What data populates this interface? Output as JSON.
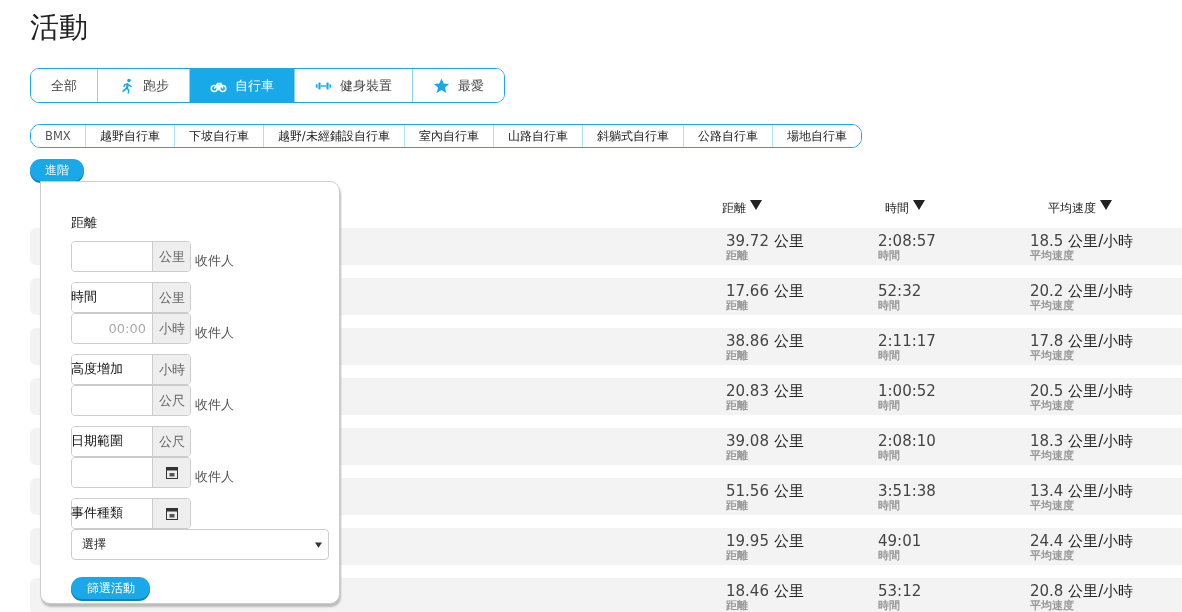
{
  "title": "活動",
  "tabs": [
    {
      "label": "全部",
      "selected": false
    },
    {
      "label": "跑步",
      "selected": false
    },
    {
      "label": "自行車",
      "selected": true
    },
    {
      "label": "健身裝置",
      "selected": false
    },
    {
      "label": "最愛",
      "selected": false
    }
  ],
  "subtypes": [
    "BMX",
    "越野自行車",
    "下坡自行車",
    "越野/未經鋪設自行車",
    "室內自行車",
    "山路自行車",
    "斜躺式自行車",
    "公路自行車",
    "場地自行車"
  ],
  "advanced_button": "進階",
  "filter_panel": {
    "groups": [
      {
        "label": "距離",
        "field": {
          "kind": "unit",
          "unit": "公里"
        },
        "to_label": "收件人"
      },
      {
        "label": "時間",
        "ghost": {
          "kind": "unit",
          "unit": "公里"
        },
        "field": {
          "kind": "unit",
          "placeholder": "00:00",
          "unit": "小時"
        },
        "to_label": "收件人"
      },
      {
        "label": "高度增加",
        "ghost": {
          "kind": "unit",
          "unit": "小時"
        },
        "field": {
          "kind": "unit",
          "unit": "公尺"
        },
        "to_label": "收件人"
      },
      {
        "label": "日期範圍",
        "ghost": {
          "kind": "unit",
          "unit": "公尺"
        },
        "field": {
          "kind": "date"
        },
        "to_label": "收件人"
      },
      {
        "label": "事件種類",
        "ghost": {
          "kind": "date"
        }
      }
    ],
    "select": "選擇",
    "apply_button": "篩選活動"
  },
  "columns": [
    "距離",
    "時間",
    "平均速度"
  ],
  "rows": [
    {
      "distance": "39.72",
      "distance_unit": "公里",
      "distance_label": "距離",
      "time": "2:08:57",
      "time_label": "時間",
      "speed": "18.5",
      "speed_unit": "公里/小時",
      "speed_label": "平均速度"
    },
    {
      "distance": "17.66",
      "distance_unit": "公里",
      "distance_label": "距離",
      "time": "52:32",
      "time_label": "時間",
      "speed": "20.2",
      "speed_unit": "公里/小時",
      "speed_label": "平均速度"
    },
    {
      "distance": "38.86",
      "distance_unit": "公里",
      "distance_label": "距離",
      "time": "2:11:17",
      "time_label": "時間",
      "speed": "17.8",
      "speed_unit": "公里/小時",
      "speed_label": "平均速度"
    },
    {
      "distance": "20.83",
      "distance_unit": "公里",
      "distance_label": "距離",
      "time": "1:00:52",
      "time_label": "時間",
      "speed": "20.5",
      "speed_unit": "公里/小時",
      "speed_label": "平均速度"
    },
    {
      "distance": "39.08",
      "distance_unit": "公里",
      "distance_label": "距離",
      "time": "2:08:10",
      "time_label": "時間",
      "speed": "18.3",
      "speed_unit": "公里/小時",
      "speed_label": "平均速度"
    },
    {
      "distance": "51.56",
      "distance_unit": "公里",
      "distance_label": "距離",
      "time": "3:51:38",
      "time_label": "時間",
      "speed": "13.4",
      "speed_unit": "公里/小時",
      "speed_label": "平均速度"
    },
    {
      "distance": "19.95",
      "distance_unit": "公里",
      "distance_label": "距離",
      "time": "49:01",
      "time_label": "時間",
      "speed": "24.4",
      "speed_unit": "公里/小時",
      "speed_label": "平均速度"
    },
    {
      "distance": "18.46",
      "distance_unit": "公里",
      "distance_label": "距離",
      "time": "53:12",
      "time_label": "時間",
      "speed": "20.8",
      "speed_unit": "公里/小時",
      "speed_label": "平均速度"
    }
  ]
}
